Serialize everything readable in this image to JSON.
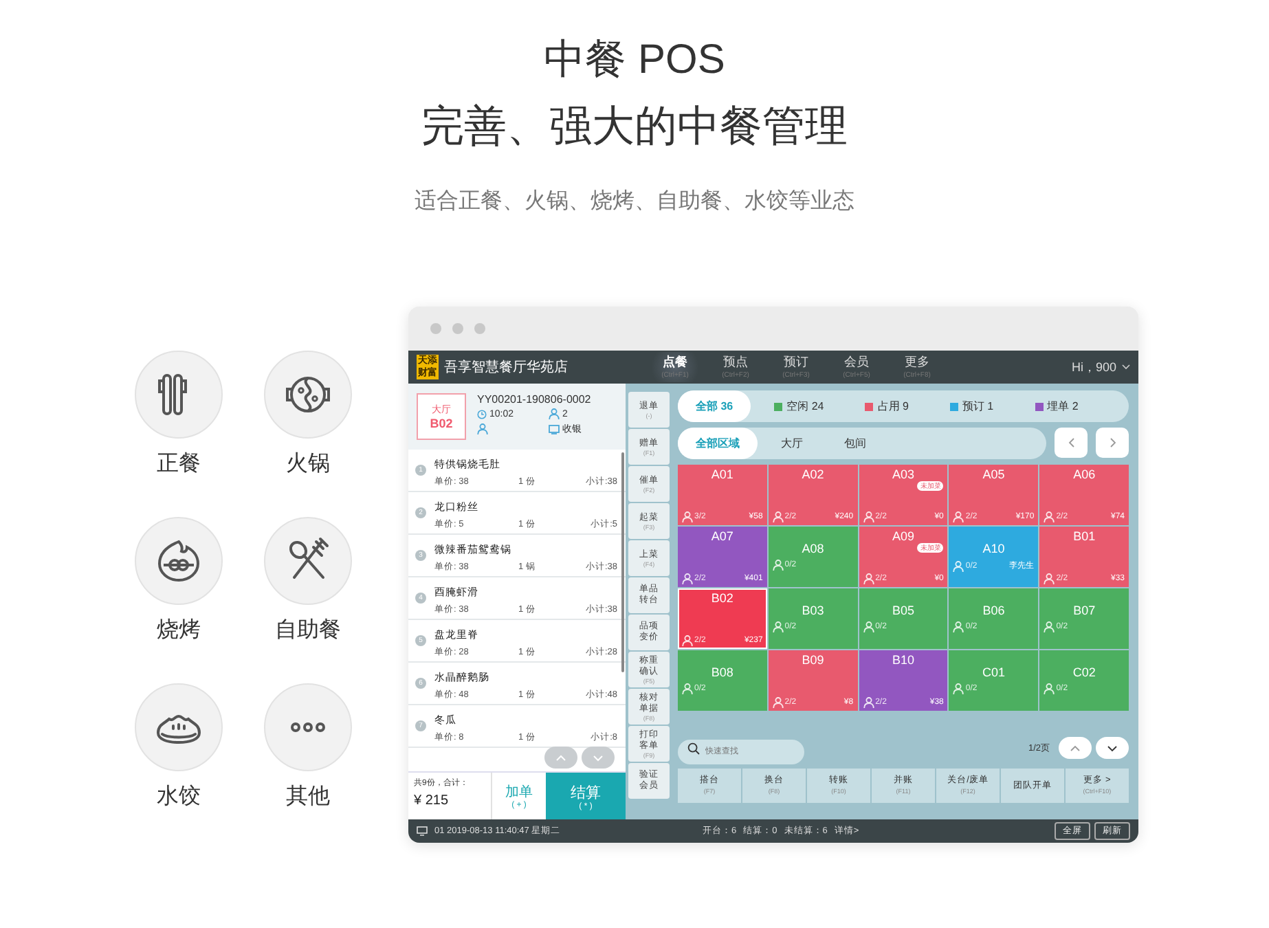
{
  "hero": {
    "title": "中餐 POS",
    "headline": "完善、强大的中餐管理",
    "subtitle": "适合正餐、火锅、烧烤、自助餐、水饺等业态"
  },
  "categories": [
    {
      "kind": "chopsticks",
      "label": "正餐"
    },
    {
      "kind": "hotpot",
      "label": "火锅"
    },
    {
      "kind": "skewer",
      "label": "烧烤"
    },
    {
      "kind": "cutlery",
      "label": "自助餐"
    },
    {
      "kind": "dumpling",
      "label": "水饺"
    },
    {
      "kind": "more",
      "label": "其他"
    }
  ],
  "app": {
    "logo": "天添财富",
    "store": "吾享智慧餐厅华苑店",
    "user": "Hi，900",
    "nav": [
      {
        "label": "点餐",
        "key": "(Ctrl+F1)",
        "selected": true
      },
      {
        "label": "预点",
        "key": "(Ctrl+F2)",
        "selected": false
      },
      {
        "label": "预订",
        "key": "(Ctrl+F3)",
        "selected": false
      },
      {
        "label": "会员",
        "key": "(Ctrl+F5)",
        "selected": false
      },
      {
        "label": "更多",
        "key": "(Ctrl+F8)",
        "selected": false
      }
    ],
    "order": {
      "area": "大厅",
      "table": "B02",
      "number": "YY00201-190806-0002",
      "time": "10:02",
      "guests": "2",
      "cashier": "收银",
      "items": [
        {
          "no": "1",
          "name": "特供锅烧毛肚",
          "price": "单价: 38",
          "qty": "1 份",
          "subtotal": "小计:38"
        },
        {
          "no": "2",
          "name": "龙口粉丝",
          "price": "单价: 5",
          "qty": "1 份",
          "subtotal": "小计:5"
        },
        {
          "no": "3",
          "name": "微辣番茄鸳鸯锅",
          "price": "单价: 38",
          "qty": "1 锅",
          "subtotal": "小计:38"
        },
        {
          "no": "4",
          "name": "酉腌虾滑",
          "price": "单价: 38",
          "qty": "1 份",
          "subtotal": "小计:38"
        },
        {
          "no": "5",
          "name": "盘龙里脊",
          "price": "单价: 28",
          "qty": "1 份",
          "subtotal": "小计:28"
        },
        {
          "no": "6",
          "name": "水晶醉鹅肠",
          "price": "单价: 48",
          "qty": "1 份",
          "subtotal": "小计:48"
        },
        {
          "no": "7",
          "name": "冬瓜",
          "price": "单价: 8",
          "qty": "1 份",
          "subtotal": "小计:8"
        }
      ],
      "total_label": "共9份，合计：",
      "total": "¥ 215",
      "add": {
        "label": "加单",
        "key": "( + )"
      },
      "pay": {
        "label": "结算",
        "key": "( * )"
      }
    },
    "side_actions": [
      {
        "label": "退单",
        "key": "(-)"
      },
      {
        "label": "赠单",
        "key": "(F1)"
      },
      {
        "label": "催单",
        "key": "(F2)"
      },
      {
        "label": "起菜",
        "key": "(F3)"
      },
      {
        "label": "上菜",
        "key": "(F4)"
      },
      {
        "label": "单品转台"
      },
      {
        "label": "品项变价"
      },
      {
        "label": "称重确认",
        "key": "(F5)"
      },
      {
        "label": "核对单据",
        "key": "(F8)"
      },
      {
        "label": "打印客单",
        "key": "(F9)"
      },
      {
        "label": "验证会员"
      }
    ],
    "status_filters": [
      {
        "label": "全部 36",
        "selected": true
      },
      {
        "label": "空闲 24",
        "color": "#4caf60",
        "selected": false
      },
      {
        "label": "占用 9",
        "color": "#e85a6e",
        "selected": false
      },
      {
        "label": "预订 1",
        "color": "#2eaadf",
        "selected": false
      },
      {
        "label": "埋单 2",
        "color": "#9257c0",
        "selected": false
      }
    ],
    "areas": [
      {
        "label": "全部区域",
        "selected": true
      },
      {
        "label": "大厅",
        "selected": false
      },
      {
        "label": "包间",
        "selected": false
      }
    ],
    "tables": [
      {
        "name": "A01",
        "kind": "occupied",
        "guests": "3/2",
        "amount": "¥58",
        "selected": false
      },
      {
        "name": "A02",
        "kind": "occupied",
        "guests": "2/2",
        "amount": "¥240",
        "selected": false
      },
      {
        "name": "A03",
        "kind": "occupied",
        "badge": "未加菜",
        "guests": "2/2",
        "amount": "¥0",
        "selected": false
      },
      {
        "name": "A05",
        "kind": "occupied",
        "guests": "2/2",
        "amount": "¥170",
        "selected": false
      },
      {
        "name": "A06",
        "kind": "occupied",
        "guests": "2/2",
        "amount": "¥74",
        "selected": false
      },
      {
        "name": "A07",
        "kind": "billing",
        "guests": "2/2",
        "amount": "¥401",
        "selected": false
      },
      {
        "name": "A08",
        "kind": "free",
        "guests": "0/2",
        "selected": false
      },
      {
        "name": "A09",
        "kind": "occupied",
        "badge": "未加菜",
        "guests": "2/2",
        "amount": "¥0",
        "selected": false
      },
      {
        "name": "A10",
        "kind": "reserved",
        "guests": "0/2",
        "customer": "李先生",
        "selected": false
      },
      {
        "name": "B01",
        "kind": "occupied",
        "guests": "2/2",
        "amount": "¥33",
        "selected": false
      },
      {
        "name": "B02",
        "kind": "occupied",
        "guests": "2/2",
        "amount": "¥237",
        "selected": true
      },
      {
        "name": "B03",
        "kind": "free",
        "guests": "0/2",
        "selected": false
      },
      {
        "name": "B05",
        "kind": "free",
        "guests": "0/2",
        "selected": false
      },
      {
        "name": "B06",
        "kind": "free",
        "guests": "0/2",
        "selected": false
      },
      {
        "name": "B07",
        "kind": "free",
        "guests": "0/2",
        "selected": false
      },
      {
        "name": "B08",
        "kind": "free",
        "guests": "0/2",
        "selected": false
      },
      {
        "name": "B09",
        "kind": "occupied",
        "guests": "2/2",
        "amount": "¥8",
        "selected": false
      },
      {
        "name": "B10",
        "kind": "billing",
        "guests": "2/2",
        "amount": "¥38",
        "selected": false
      },
      {
        "name": "C01",
        "kind": "free",
        "guests": "0/2",
        "selected": false
      },
      {
        "name": "C02",
        "kind": "free",
        "guests": "0/2",
        "selected": false
      }
    ],
    "search": {
      "placeholder": "快速查找"
    },
    "page": "1/2页",
    "actions": [
      {
        "label": "搭台",
        "key": "(F7)"
      },
      {
        "label": "换台",
        "key": "(F8)"
      },
      {
        "label": "转账",
        "key": "(F10)"
      },
      {
        "label": "并账",
        "key": "(F11)"
      },
      {
        "label": "关台/废单",
        "key": "(F12)"
      },
      {
        "label": "团队开单"
      },
      {
        "label": "更多 >",
        "key": "(Ctrl+F10)"
      }
    ],
    "status_bar": {
      "info": "01 2019-08-13 11:40:47 星期二",
      "stats": [
        "开台：6",
        "结算：0",
        "未结算：6",
        "详情>"
      ],
      "buttons": [
        "全屏",
        "刷新"
      ]
    }
  }
}
